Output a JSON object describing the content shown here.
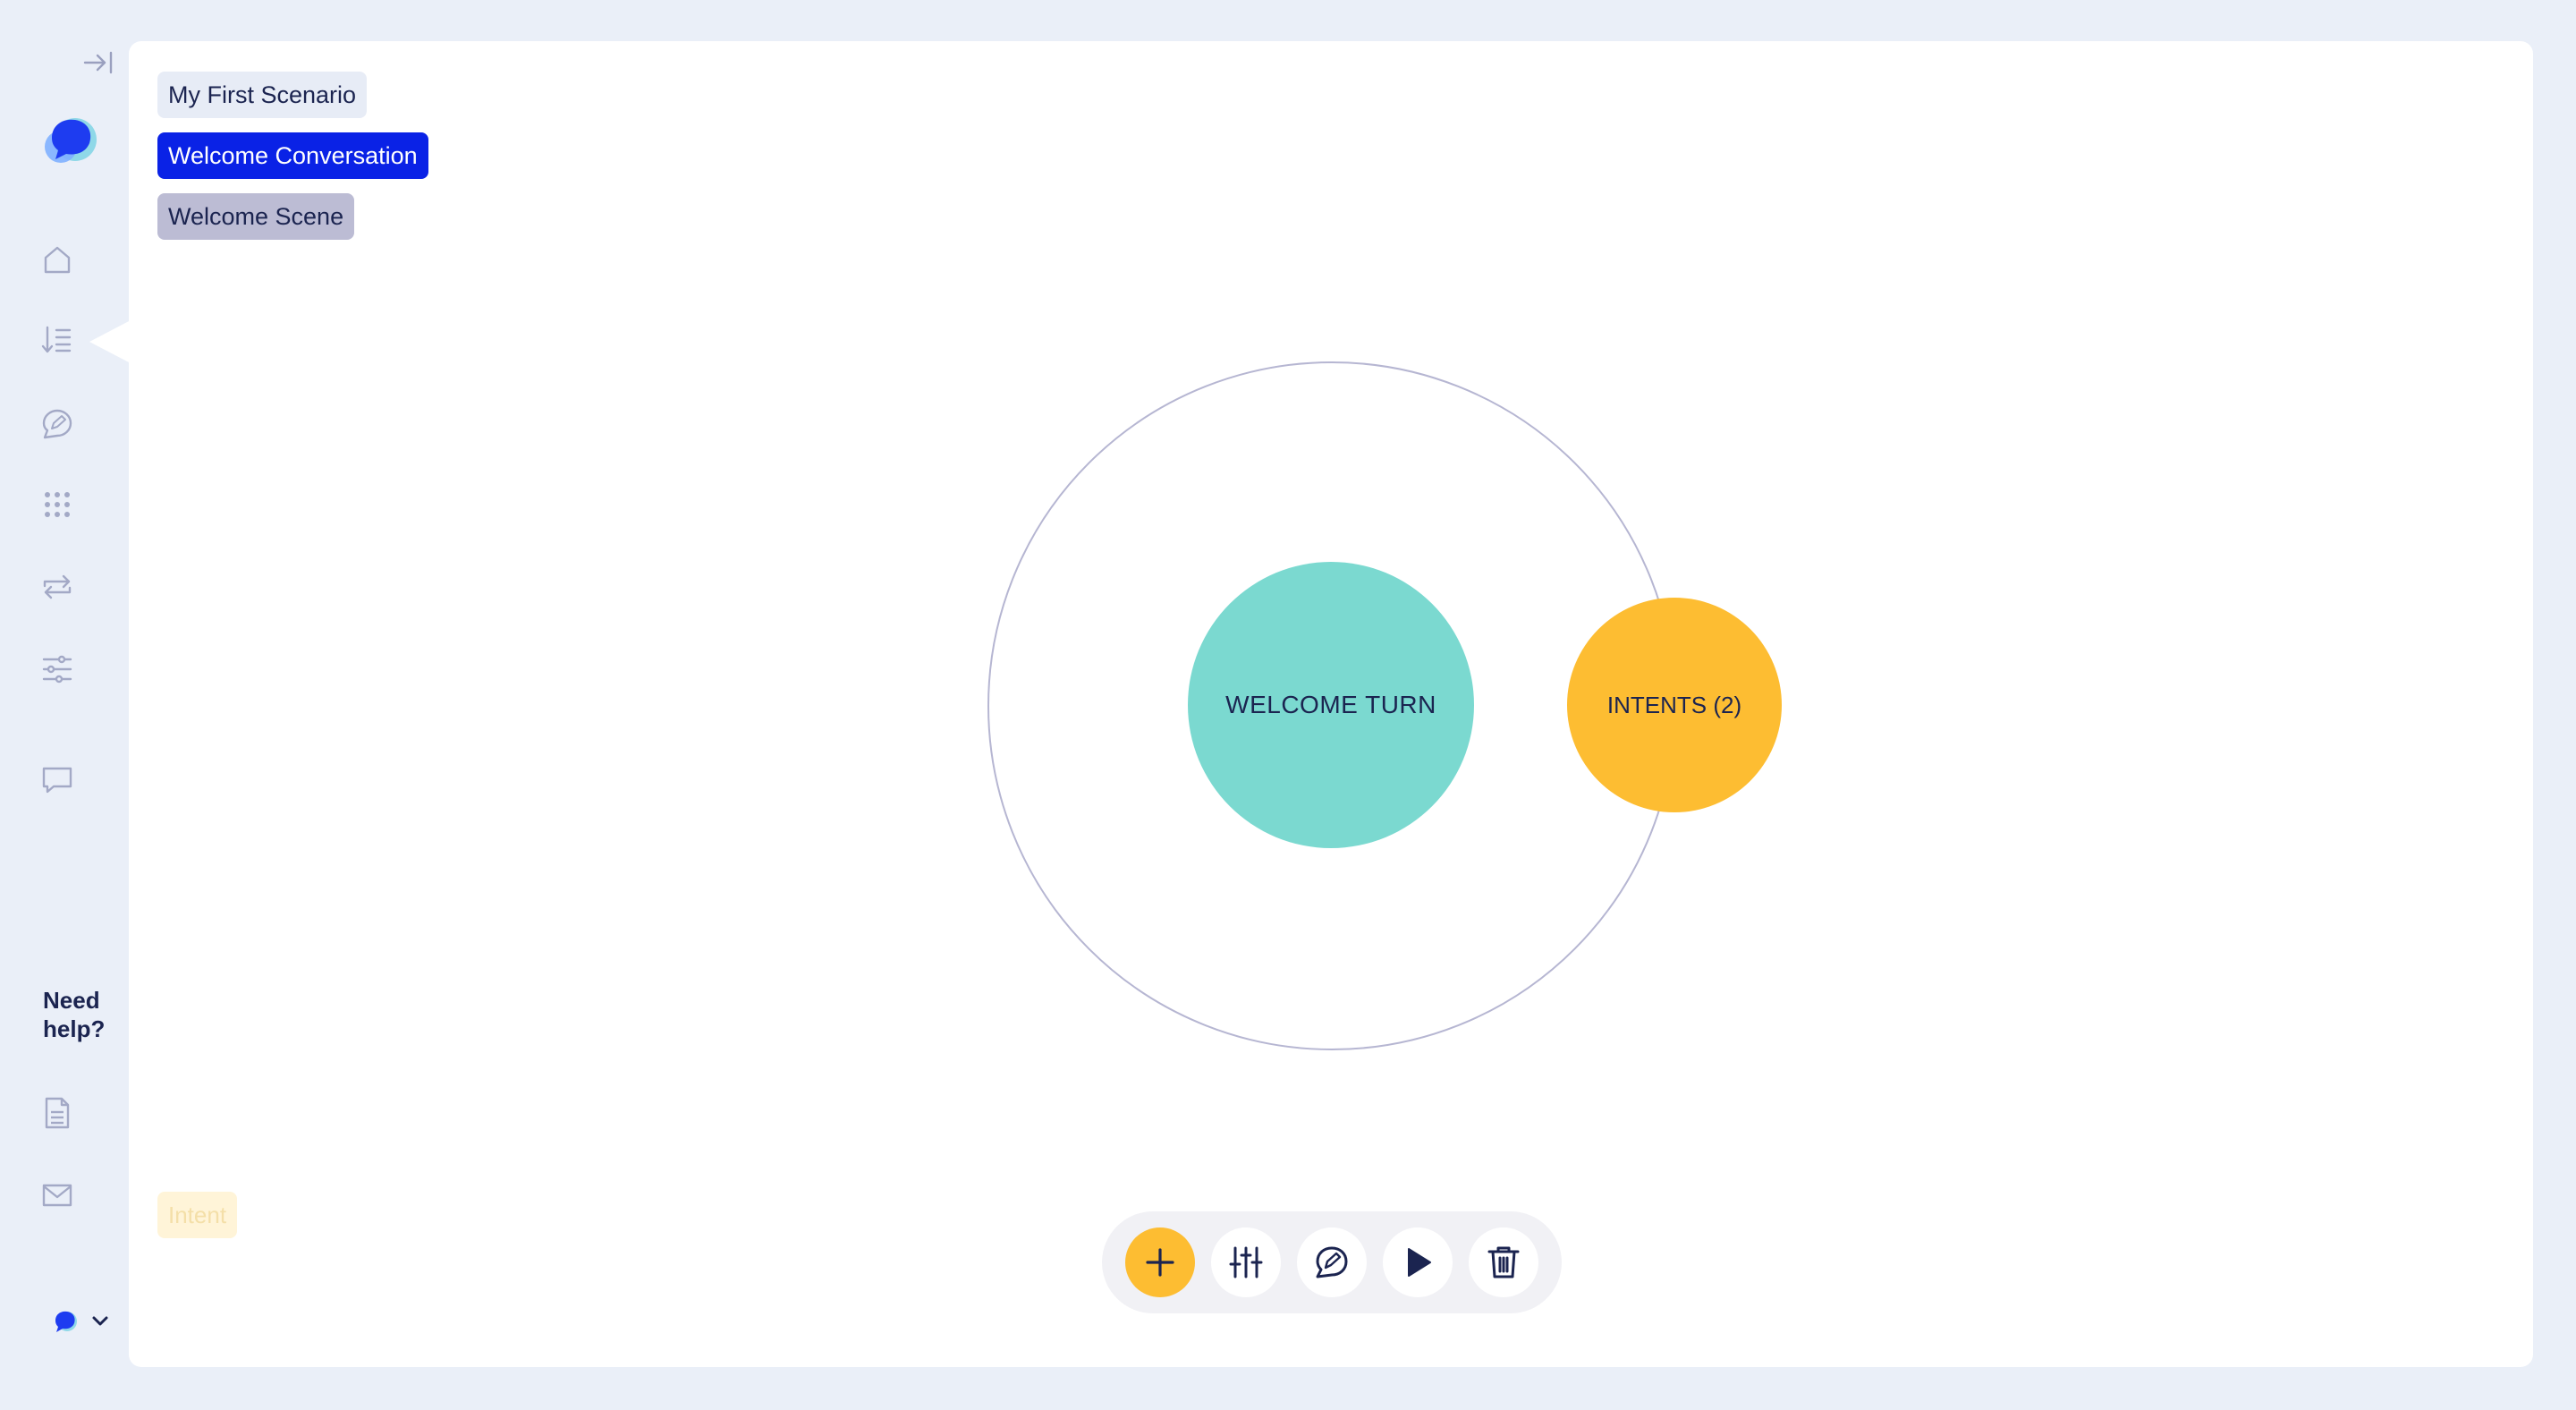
{
  "sidebar": {
    "help_title": "Need help?",
    "icons": {
      "collapse": "collapse-sidebar-icon",
      "logo": "app-logo",
      "home": "home-icon",
      "conversations": "conversations-list-icon",
      "messages": "message-editor-icon",
      "apps": "grid-dots-icon",
      "transitions": "repeat-arrows-icon",
      "settings": "sliders-icon",
      "chat": "chat-bubble-icon",
      "docs": "document-icon",
      "mail": "mail-icon",
      "account": "account-chevron-down-icon"
    }
  },
  "breadcrumbs": {
    "scenario": "My First Scenario",
    "conversation": "Welcome Conversation",
    "scene": "Welcome Scene"
  },
  "graph": {
    "turn_label": "WELCOME TURN",
    "intents_label": "INTENTS (2)"
  },
  "legend": {
    "intent": "Intent"
  },
  "toolbar": {
    "buttons": [
      "plus-icon",
      "sliders-icon",
      "message-editor-icon",
      "play-icon",
      "trash-icon"
    ]
  },
  "colors": {
    "background": "#eaeff8",
    "canvas": "#ffffff",
    "accent_blue": "#0a22e6",
    "turn": "#7bd9d0",
    "intent": "#fdbd32",
    "scene": "#bcbcd4",
    "text_dark": "#1b2450",
    "icon_muted": "#a3a9c6"
  }
}
